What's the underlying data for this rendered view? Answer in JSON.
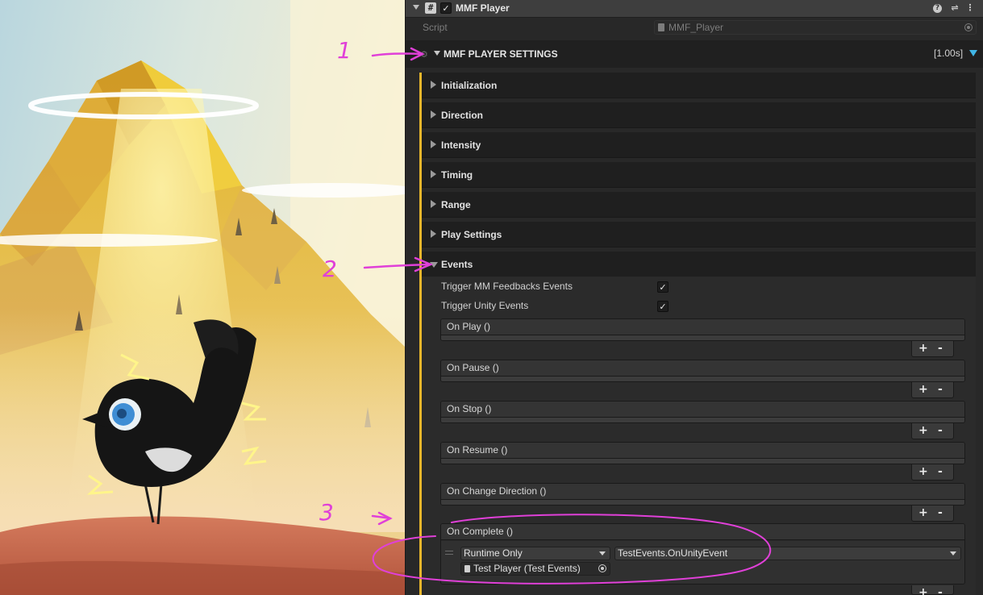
{
  "component": {
    "title": "MMF Player",
    "script_label": "Script",
    "script_value": "MMF_Player",
    "icons": [
      "script-icon",
      "help-icon",
      "settings-sliders-icon",
      "kebab-menu-icon"
    ]
  },
  "settings": {
    "title": "MMF PLAYER SETTINGS",
    "duration": "[1.00s]",
    "accent_color": "#41b6e6",
    "section_bar_color": "#e7b62b"
  },
  "sections": [
    {
      "label": "Initialization",
      "expanded": false
    },
    {
      "label": "Direction",
      "expanded": false
    },
    {
      "label": "Intensity",
      "expanded": false
    },
    {
      "label": "Timing",
      "expanded": false
    },
    {
      "label": "Range",
      "expanded": false
    },
    {
      "label": "Play Settings",
      "expanded": false
    },
    {
      "label": "Events",
      "expanded": true
    }
  ],
  "events": {
    "trigger_mm_label": "Trigger MM Feedbacks Events",
    "trigger_mm_checked": true,
    "trigger_unity_label": "Trigger Unity Events",
    "trigger_unity_checked": true,
    "check_glyph": "✓",
    "plus": "+",
    "minus": "-",
    "on_play": "On Play ()",
    "on_pause": "On Pause ()",
    "on_stop": "On Stop ()",
    "on_resume": "On Resume ()",
    "on_change_direction": "On Change Direction ()",
    "on_complete": "On Complete ()",
    "on_complete_entry": {
      "mode": "Runtime Only",
      "function": "TestEvents.OnUnityEvent",
      "target": "Test Player (Test Events)"
    }
  },
  "annotations": {
    "marker_1": "1",
    "marker_2": "2",
    "marker_3": "3",
    "ink_color": "#e040d8"
  }
}
